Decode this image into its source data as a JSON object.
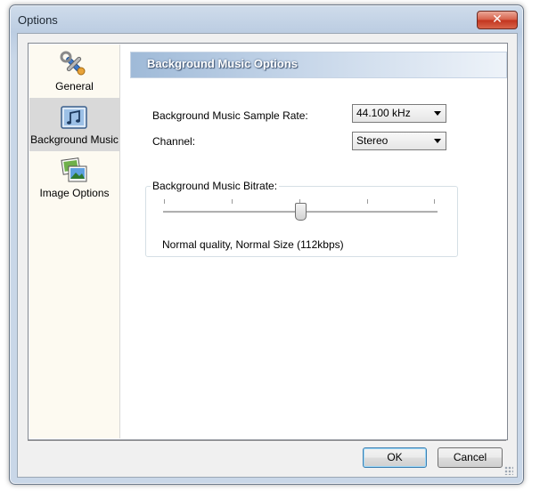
{
  "window": {
    "title": "Options",
    "close_symbol": "✕"
  },
  "sidebar": {
    "items": [
      {
        "label": "General",
        "icon": "tools-icon",
        "active": false
      },
      {
        "label": "Background Music",
        "icon": "music-icon",
        "active": true
      },
      {
        "label": "Image Options",
        "icon": "images-icon",
        "active": false
      }
    ]
  },
  "panel": {
    "header": "Background Music Options",
    "sample_rate_label": "Background Music Sample Rate:",
    "sample_rate_value": "44.100 kHz",
    "channel_label": "Channel:",
    "channel_value": "Stereo",
    "bitrate_label": "Background Music Bitrate:",
    "bitrate_status": "Normal quality, Normal Size (112kbps)",
    "bitrate_slider_position": 0.5
  },
  "buttons": {
    "ok": "OK",
    "cancel": "Cancel"
  },
  "colors": {
    "header_gradient_start": "#9fbad8",
    "sidebar_bg": "#fdfaf1",
    "active_item_bg": "#d9d9d9",
    "close_button": "#c2341e"
  }
}
